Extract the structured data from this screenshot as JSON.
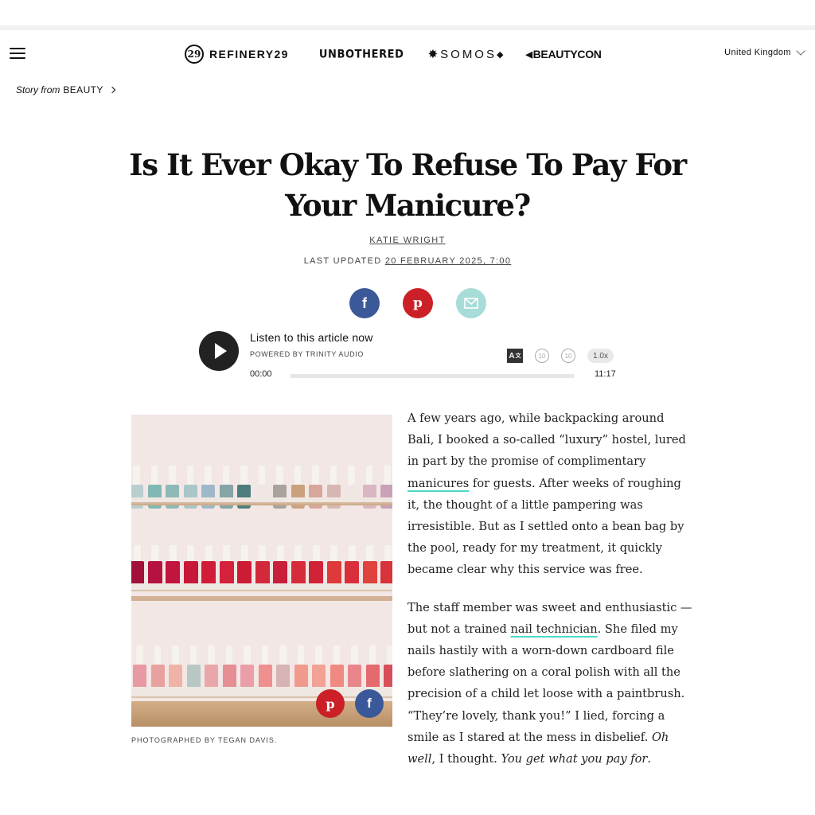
{
  "nav": {
    "brands": [
      "REFINERY29",
      "UNBOTHERED",
      "SOMOS",
      "BEAUTYCON"
    ],
    "logo_mark": "29",
    "region": "United Kingdom"
  },
  "breadcrumb": {
    "prefix": "Story",
    "from": "from",
    "section": "BEAUTY"
  },
  "article": {
    "title": "Is It Ever Okay To Refuse To Pay For Your Manicure?",
    "author": "KATIE WRIGHT",
    "updated_label": "LAST UPDATED",
    "updated_date": "20 FEBRUARY 2025, 7:00"
  },
  "share": {
    "facebook": "f",
    "pinterest": "p"
  },
  "audio": {
    "title": "Listen to this article now",
    "powered_by": "POWERED BY  TRINITY AUDIO",
    "translate_glyph": "A",
    "skip_back": "10",
    "skip_forward": "10",
    "speed": "1.0x",
    "current_time": "00:00",
    "duration": "11:17",
    "progress": 0
  },
  "image": {
    "caption": "PHOTOGRAPHED BY TEGAN DAVIS."
  },
  "body": {
    "p1_a": "A few years ago, while backpacking around Bali, I booked a so-called “luxury” hostel, lured in part by the promise of complimentary ",
    "p1_link": "manicures",
    "p1_b": " for guests. After weeks of roughing it, the thought of a little pampering was irresistible. But as I settled onto a bean bag by the pool, ready for my treatment, it quickly became clear why this service was free.",
    "p2_a": "The staff member was sweet and enthusiastic — but not a trained ",
    "p2_link": "nail technician",
    "p2_b": ". She filed my nails hastily with a worn-down cardboard file before slathering on a coral polish with all the precision of a child let loose with a paintbrush. “They’re lovely, thank you!” I lied, forcing a smile as I stared at the mess in disbelief. ",
    "p2_it1": "Oh well",
    "p2_c": ", I thought. ",
    "p2_it2": "You get what you pay for",
    "p2_d": "."
  },
  "colors": {
    "facebook": "#3b5998",
    "pinterest": "#cb2027",
    "email": "#a7dcd8",
    "link_underline": "#4fd7c7"
  }
}
